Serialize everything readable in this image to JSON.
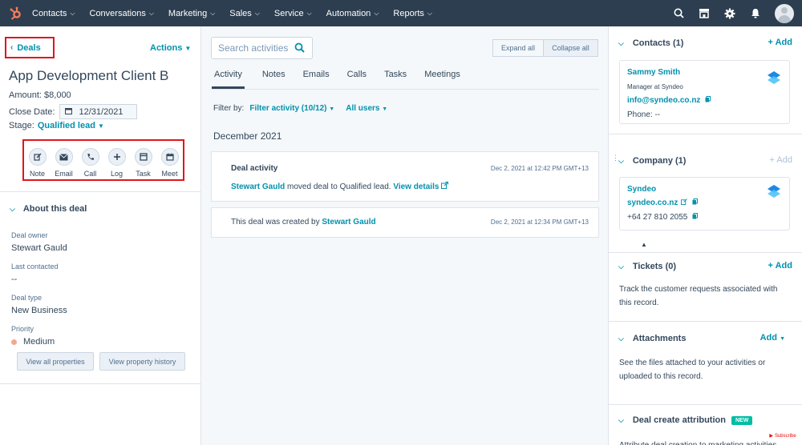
{
  "nav": {
    "items": [
      "Contacts",
      "Conversations",
      "Marketing",
      "Sales",
      "Service",
      "Automation",
      "Reports"
    ]
  },
  "left": {
    "back_label": "Deals",
    "actions_label": "Actions",
    "deal_title": "App Development Client B",
    "amount_label": "Amount:",
    "amount_value": "$8,000",
    "close_date_label": "Close Date:",
    "close_date_value": "12/31/2021",
    "stage_label": "Stage:",
    "stage_value": "Qualified lead",
    "actions": [
      "Note",
      "Email",
      "Call",
      "Log",
      "Task",
      "Meet"
    ],
    "about_title": "About this deal",
    "props": [
      {
        "label": "Deal owner",
        "value": "Stewart Gauld"
      },
      {
        "label": "Last contacted",
        "value": "--"
      },
      {
        "label": "Deal type",
        "value": "New Business"
      },
      {
        "label": "Priority",
        "value": "Medium"
      }
    ],
    "view_all_label": "View all properties",
    "view_history_label": "View property history"
  },
  "middle": {
    "search_placeholder": "Search activities",
    "expand_all": "Expand all",
    "collapse_all": "Collapse all",
    "tabs": [
      "Activity",
      "Notes",
      "Emails",
      "Calls",
      "Tasks",
      "Meetings"
    ],
    "filter_by_label": "Filter by:",
    "filter_activity": "Filter activity (10/12)",
    "all_users": "All users",
    "month": "December 2021",
    "card1": {
      "title": "Deal activity",
      "date": "Dec 2, 2021 at 12:42 PM GMT+13",
      "actor": "Stewart Gauld",
      "text": " moved deal to Qualified lead. ",
      "link": "View details"
    },
    "card2": {
      "text": "This deal was created by ",
      "actor": "Stewart Gauld",
      "date": "Dec 2, 2021 at 12:34 PM GMT+13"
    }
  },
  "right": {
    "contacts_title": "Contacts (1)",
    "add_label": "+ Add",
    "contact_name": "Sammy Smith",
    "contact_role": "Manager at Syndeo",
    "contact_email": "info@syndeo.co.nz",
    "contact_phone": "Phone: --",
    "company_title": "Company (1)",
    "company_name": "Syndeo",
    "company_domain": "syndeo.co.nz",
    "company_phone": "+64 27 810 2055",
    "tickets_title": "Tickets (0)",
    "tickets_text": "Track the customer requests associated with this record.",
    "attachments_title": "Attachments",
    "attachments_add": "Add",
    "attachments_text": "See the files attached to your activities or uploaded to this record.",
    "attribution_title": "Deal create attribution",
    "new_badge": "NEW",
    "attribution_text": "Attribute deal creation to marketing activities",
    "subscribe": "Subscribe"
  },
  "colors": {
    "nav_bg": "#2d3e50",
    "link": "#0091ae",
    "highlight": "#e0161c",
    "new_badge": "#00bda5"
  }
}
